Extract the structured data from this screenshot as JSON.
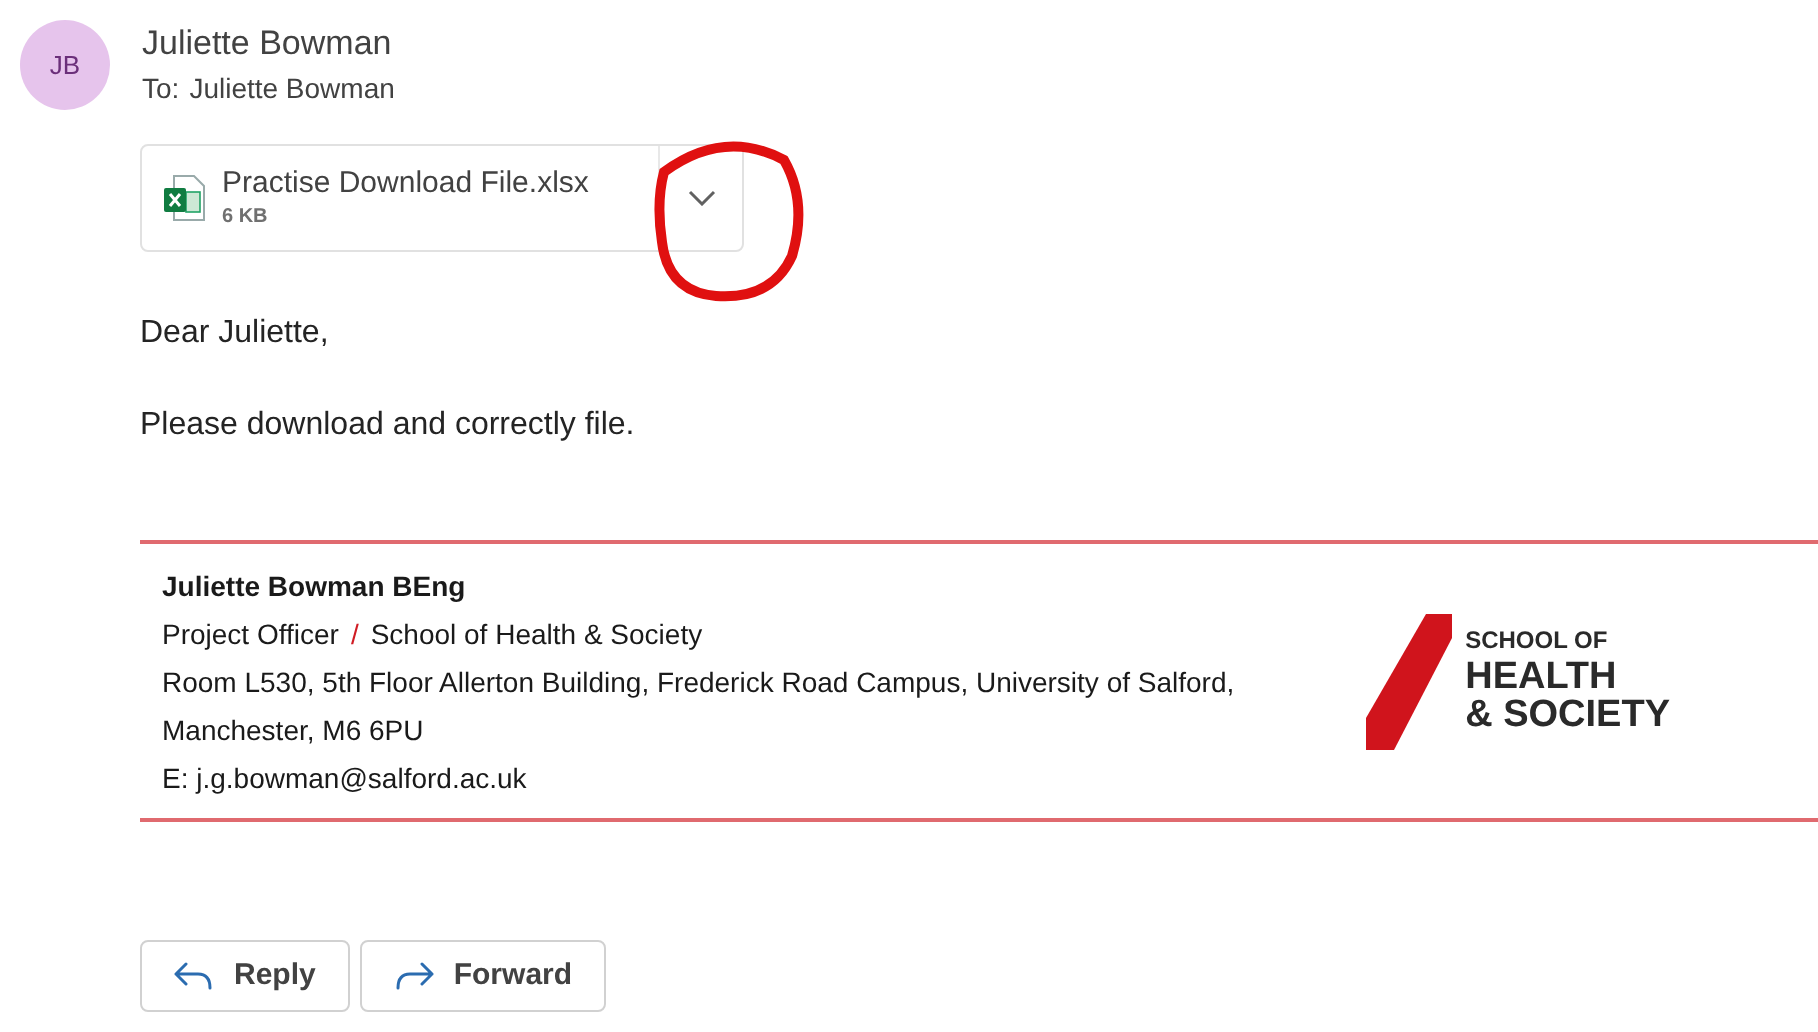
{
  "sender": {
    "initials": "JB",
    "name": "Juliette Bowman",
    "to_label": "To:",
    "to": "Juliette Bowman"
  },
  "attachment": {
    "name": "Practise Download File.xlsx",
    "size": "6 KB"
  },
  "body": [
    "Dear Juliette,",
    "Please download and correctly file."
  ],
  "signature": {
    "name": "Juliette Bowman BEng",
    "role": "Project Officer",
    "separator": "/",
    "department": "School of Health & Society",
    "address": "Room L530, 5th Floor Allerton Building, Frederick Road Campus, University of Salford, Manchester, M6 6PU",
    "email": "E: j.g.bowman@salford.ac.uk",
    "logo": [
      "SCHOOL OF",
      "HEALTH",
      "& SOCIETY"
    ]
  },
  "actions": [
    {
      "kind": "reply",
      "label": "Reply"
    },
    {
      "kind": "forward",
      "label": "Forward"
    }
  ]
}
